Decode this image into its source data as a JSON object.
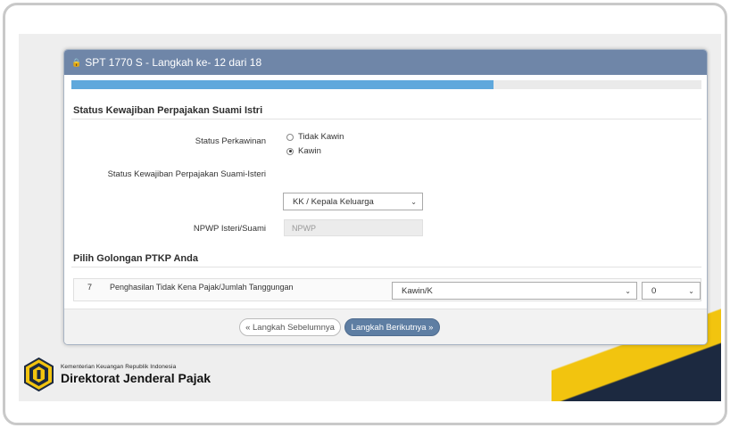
{
  "window": {
    "title": "SPT 1770 S - Langkah ke- 12 dari 18",
    "title_icon": "lock-icon",
    "progress_fraction": 0.67
  },
  "section_status": {
    "title": "Status Kewajiban Perpajakan Suami Istri",
    "marital_label": "Status Perkawinan",
    "options": [
      "Tidak Kawin",
      "Kawin"
    ],
    "selected_option": "Kawin",
    "obligation_label": "Status Kewajiban Perpajakan Suami-Isteri",
    "obligation_value": "KK / Kepala Keluarga",
    "npwp_label": "NPWP Isteri/Suami",
    "npwp_placeholder": "NPWP"
  },
  "section_ptkp": {
    "title": "Pilih Golongan PTKP Anda",
    "row_number": "7",
    "row_description": "Penghasilan Tidak Kena Pajak/Jumlah Tanggungan",
    "status_value": "Kawin/K",
    "dependents_value": "0"
  },
  "buttons": {
    "prev_label": "« Langkah Sebelumnya",
    "next_label": "Langkah Berikutnya »"
  },
  "logo": {
    "ministry": "Kementerian Keuangan Republik Indonesia",
    "agency": "Direktorat Jenderal Pajak"
  },
  "colors": {
    "header": "#6f86a8",
    "progress": "#5fa8dc",
    "next_button": "#5e7ea3",
    "gold": "#f2c40f",
    "navy": "#1c2940"
  }
}
